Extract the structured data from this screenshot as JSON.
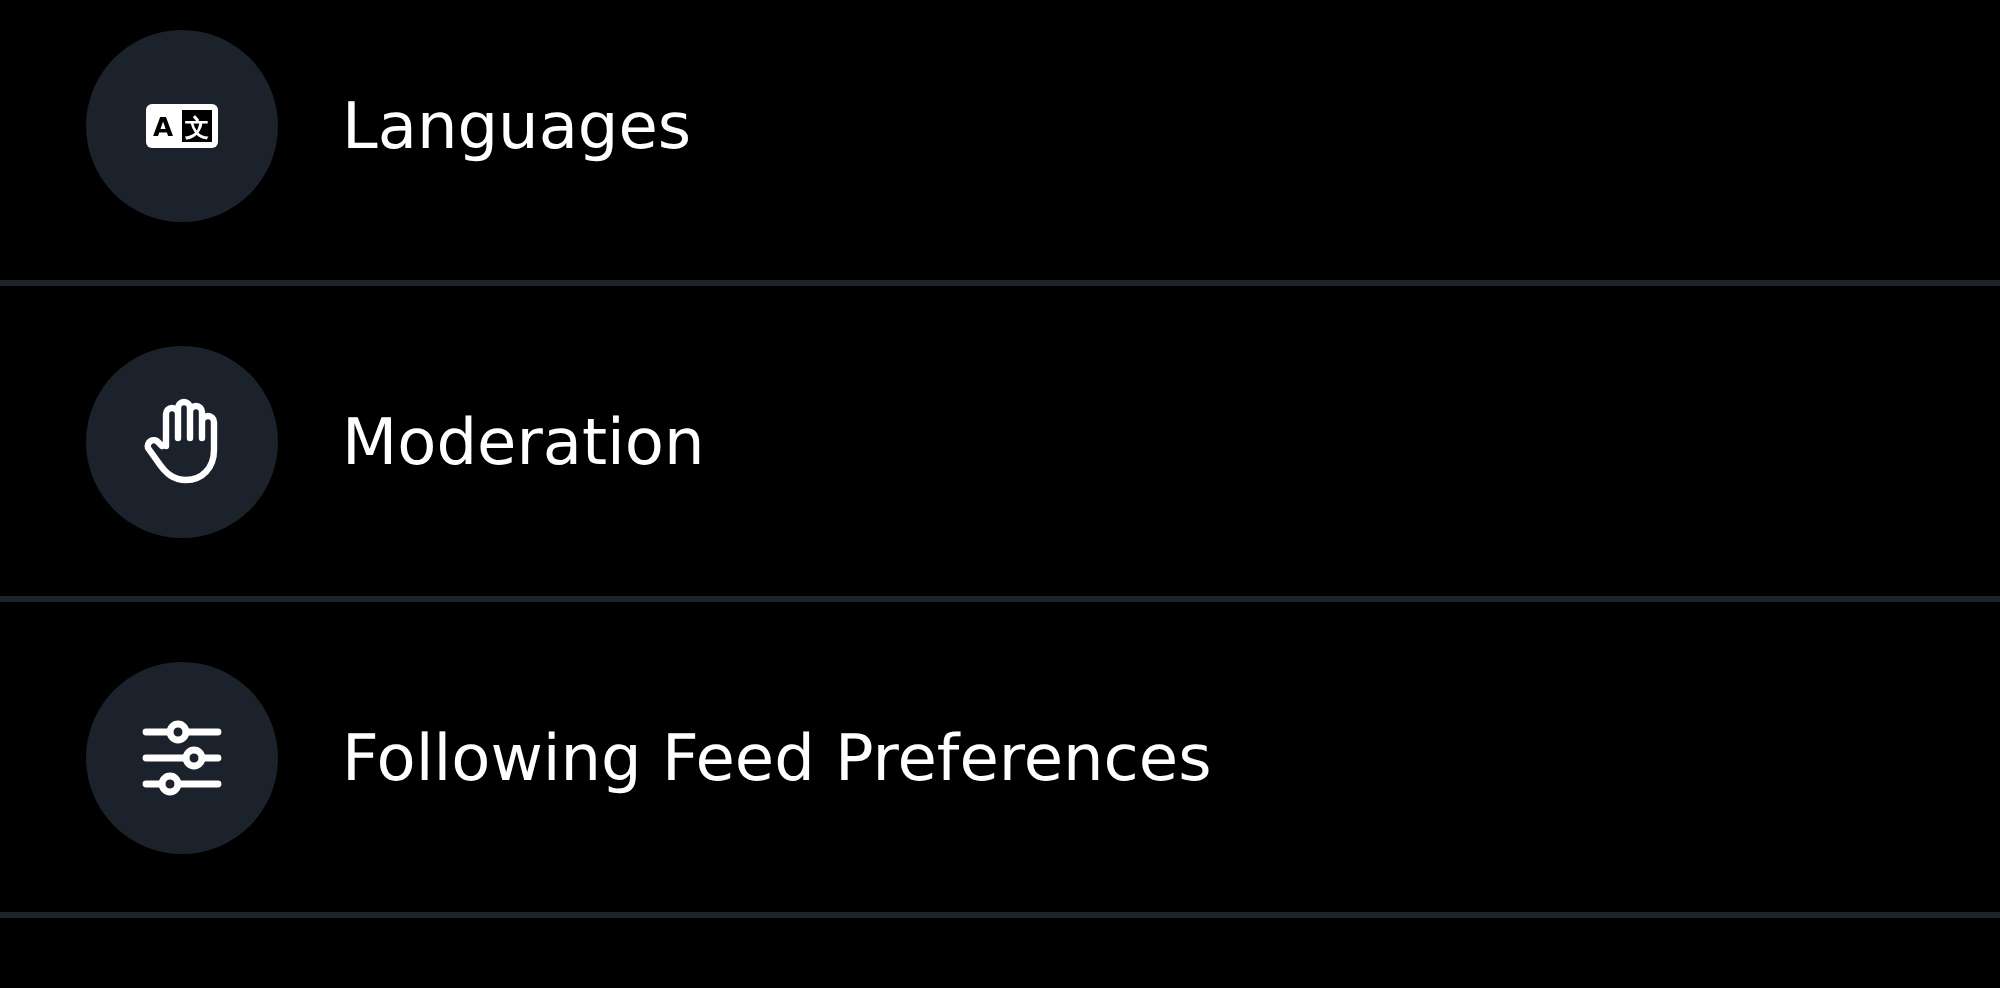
{
  "settings_items": [
    {
      "kind": "translate",
      "label": "Languages",
      "icon_glyphs": [
        "A",
        "文"
      ]
    },
    {
      "kind": "hand",
      "label": "Moderation"
    },
    {
      "kind": "sliders",
      "label": "Following Feed Preferences"
    }
  ]
}
